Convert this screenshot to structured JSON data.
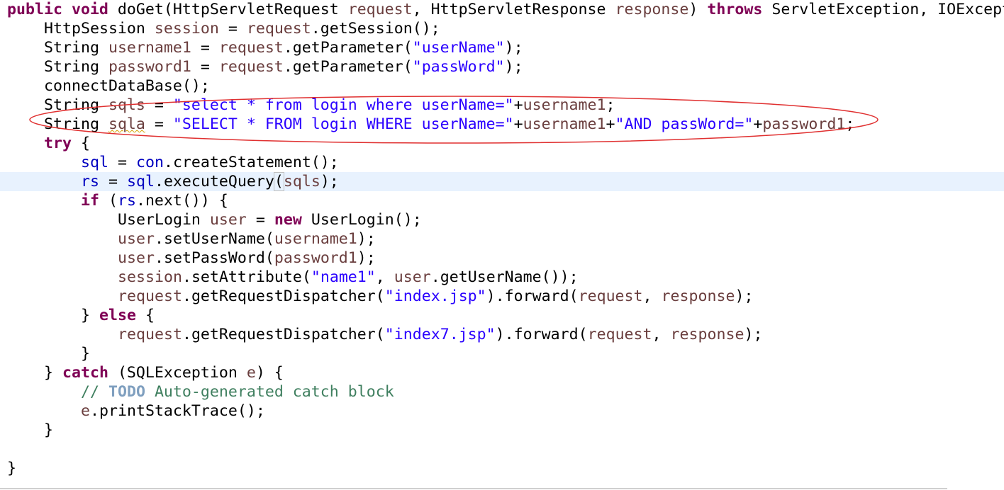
{
  "editor": {
    "language": "java",
    "highlighted_line": 10,
    "annotation": {
      "shape": "ellipse",
      "color": "#e03030",
      "marks_lines": [
        6,
        7
      ]
    },
    "colors": {
      "keyword": "#7f0055",
      "string": "#2a00ff",
      "field": "#0000c0",
      "local_variable": "#6a3e3e",
      "comment": "#3f7f5f",
      "todo_tag": "#7f9fbf",
      "current_line": "#e8f2fe"
    },
    "lines": [
      {
        "indent": 0,
        "tokens": [
          {
            "t": "public",
            "c": "kw"
          },
          {
            "t": " "
          },
          {
            "t": "void",
            "c": "kw"
          },
          {
            "t": " doGet(HttpServletRequest "
          },
          {
            "t": "request",
            "c": "var"
          },
          {
            "t": ", HttpServletResponse "
          },
          {
            "t": "response",
            "c": "var"
          },
          {
            "t": ") "
          },
          {
            "t": "throws",
            "c": "kw"
          },
          {
            "t": " ServletException, IOExcept"
          }
        ]
      },
      {
        "indent": 4,
        "tokens": [
          {
            "t": "HttpSession "
          },
          {
            "t": "session",
            "c": "var"
          },
          {
            "t": " = "
          },
          {
            "t": "request",
            "c": "var"
          },
          {
            "t": ".getSession();"
          }
        ]
      },
      {
        "indent": 4,
        "tokens": [
          {
            "t": "String "
          },
          {
            "t": "username1",
            "c": "var"
          },
          {
            "t": " = "
          },
          {
            "t": "request",
            "c": "var"
          },
          {
            "t": ".getParameter("
          },
          {
            "t": "\"userName\"",
            "c": "str"
          },
          {
            "t": ");"
          }
        ]
      },
      {
        "indent": 4,
        "tokens": [
          {
            "t": "String "
          },
          {
            "t": "password1",
            "c": "var"
          },
          {
            "t": " = "
          },
          {
            "t": "request",
            "c": "var"
          },
          {
            "t": ".getParameter("
          },
          {
            "t": "\"passWord\"",
            "c": "str"
          },
          {
            "t": ");"
          }
        ]
      },
      {
        "indent": 4,
        "tokens": [
          {
            "t": "connectDataBase();"
          }
        ]
      },
      {
        "indent": 4,
        "tokens": [
          {
            "t": "String "
          },
          {
            "t": "sqls",
            "c": "var"
          },
          {
            "t": " = "
          },
          {
            "t": "\"select * from login where userName=\"",
            "c": "str"
          },
          {
            "t": "+"
          },
          {
            "t": "username1",
            "c": "var"
          },
          {
            "t": ";"
          }
        ]
      },
      {
        "indent": 4,
        "tokens": [
          {
            "t": "String "
          },
          {
            "t": "sqla",
            "c": "var",
            "warn": true
          },
          {
            "t": " = "
          },
          {
            "t": "\"SELECT * FROM login WHERE userName=\"",
            "c": "str"
          },
          {
            "t": "+"
          },
          {
            "t": "username1",
            "c": "var"
          },
          {
            "t": "+"
          },
          {
            "t": "\"AND passWord=\"",
            "c": "str"
          },
          {
            "t": "+"
          },
          {
            "t": "password1",
            "c": "var"
          },
          {
            "t": ";"
          }
        ]
      },
      {
        "indent": 4,
        "tokens": [
          {
            "t": "try",
            "c": "kw"
          },
          {
            "t": " {"
          }
        ]
      },
      {
        "indent": 8,
        "tokens": [
          {
            "t": "sql",
            "c": "fld"
          },
          {
            "t": " = "
          },
          {
            "t": "con",
            "c": "fld"
          },
          {
            "t": ".createStatement();"
          }
        ]
      },
      {
        "indent": 8,
        "tokens": [
          {
            "t": "rs",
            "c": "fld"
          },
          {
            "t": " = "
          },
          {
            "t": "sql",
            "c": "fld"
          },
          {
            "t": ".executeQuery"
          },
          {
            "t": "(",
            "c": "bm"
          },
          {
            "t": "sqls",
            "c": "var"
          },
          {
            "t": ");"
          }
        ]
      },
      {
        "indent": 8,
        "tokens": [
          {
            "t": "if",
            "c": "kw"
          },
          {
            "t": " ("
          },
          {
            "t": "rs",
            "c": "fld"
          },
          {
            "t": ".next()) {"
          }
        ]
      },
      {
        "indent": 12,
        "tokens": [
          {
            "t": "UserLogin "
          },
          {
            "t": "user",
            "c": "var"
          },
          {
            "t": " = "
          },
          {
            "t": "new",
            "c": "kw"
          },
          {
            "t": " UserLogin();"
          }
        ]
      },
      {
        "indent": 12,
        "tokens": [
          {
            "t": "user",
            "c": "var"
          },
          {
            "t": ".setUserName("
          },
          {
            "t": "username1",
            "c": "var"
          },
          {
            "t": ");"
          }
        ]
      },
      {
        "indent": 12,
        "tokens": [
          {
            "t": "user",
            "c": "var"
          },
          {
            "t": ".setPassWord("
          },
          {
            "t": "password1",
            "c": "var"
          },
          {
            "t": ");"
          }
        ]
      },
      {
        "indent": 12,
        "tokens": [
          {
            "t": "session",
            "c": "var"
          },
          {
            "t": ".setAttribute("
          },
          {
            "t": "\"name1\"",
            "c": "str"
          },
          {
            "t": ", "
          },
          {
            "t": "user",
            "c": "var"
          },
          {
            "t": ".getUserName());"
          }
        ]
      },
      {
        "indent": 12,
        "tokens": [
          {
            "t": "request",
            "c": "var"
          },
          {
            "t": ".getRequestDispatcher("
          },
          {
            "t": "\"index.jsp\"",
            "c": "str"
          },
          {
            "t": ").forward("
          },
          {
            "t": "request",
            "c": "var"
          },
          {
            "t": ", "
          },
          {
            "t": "response",
            "c": "var"
          },
          {
            "t": ");"
          }
        ]
      },
      {
        "indent": 8,
        "tokens": [
          {
            "t": "} "
          },
          {
            "t": "else",
            "c": "kw"
          },
          {
            "t": " {"
          }
        ]
      },
      {
        "indent": 12,
        "tokens": [
          {
            "t": "request",
            "c": "var"
          },
          {
            "t": ".getRequestDispatcher("
          },
          {
            "t": "\"index7.jsp\"",
            "c": "str"
          },
          {
            "t": ").forward("
          },
          {
            "t": "request",
            "c": "var"
          },
          {
            "t": ", "
          },
          {
            "t": "response",
            "c": "var"
          },
          {
            "t": ");"
          }
        ]
      },
      {
        "indent": 8,
        "tokens": [
          {
            "t": "}"
          }
        ]
      },
      {
        "indent": 4,
        "tokens": [
          {
            "t": "} "
          },
          {
            "t": "catch",
            "c": "kw"
          },
          {
            "t": " (SQLException "
          },
          {
            "t": "e",
            "c": "var"
          },
          {
            "t": ") {"
          }
        ]
      },
      {
        "indent": 8,
        "tokens": [
          {
            "t": "// ",
            "c": "cmt"
          },
          {
            "t": "TODO",
            "c": "todo"
          },
          {
            "t": " Auto-generated catch block",
            "c": "cmt"
          }
        ]
      },
      {
        "indent": 8,
        "tokens": [
          {
            "t": "e",
            "c": "var"
          },
          {
            "t": ".printStackTrace();"
          }
        ]
      },
      {
        "indent": 4,
        "tokens": [
          {
            "t": "}"
          }
        ]
      },
      {
        "indent": 0,
        "tokens": []
      },
      {
        "indent": 0,
        "tokens": [
          {
            "t": "}"
          }
        ]
      }
    ]
  }
}
